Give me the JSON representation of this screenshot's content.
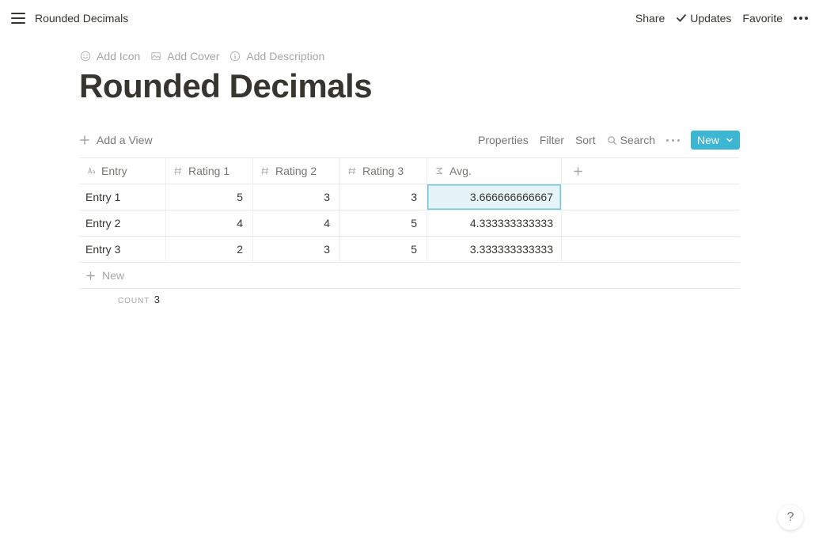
{
  "topbar": {
    "breadcrumb": "Rounded Decimals",
    "share": "Share",
    "updates": "Updates",
    "favorite": "Favorite"
  },
  "page_actions": {
    "add_icon": "Add Icon",
    "add_cover": "Add Cover",
    "add_description": "Add Description"
  },
  "page_title": "Rounded Decimals",
  "db_toolbar": {
    "add_view": "Add a View",
    "properties": "Properties",
    "filter": "Filter",
    "sort": "Sort",
    "search": "Search",
    "new": "New"
  },
  "columns": {
    "entry": "Entry",
    "rating1": "Rating 1",
    "rating2": "Rating 2",
    "rating3": "Rating 3",
    "avg": "Avg."
  },
  "rows": [
    {
      "entry": "Entry 1",
      "r1": "5",
      "r2": "3",
      "r3": "3",
      "avg": "3.666666666667"
    },
    {
      "entry": "Entry 2",
      "r1": "4",
      "r2": "4",
      "r3": "5",
      "avg": "4.333333333333"
    },
    {
      "entry": "Entry 3",
      "r1": "2",
      "r2": "3",
      "r3": "5",
      "avg": "3.333333333333"
    }
  ],
  "new_row": "New",
  "footer": {
    "count_label": "COUNT",
    "count_val": "3"
  },
  "help": "?"
}
